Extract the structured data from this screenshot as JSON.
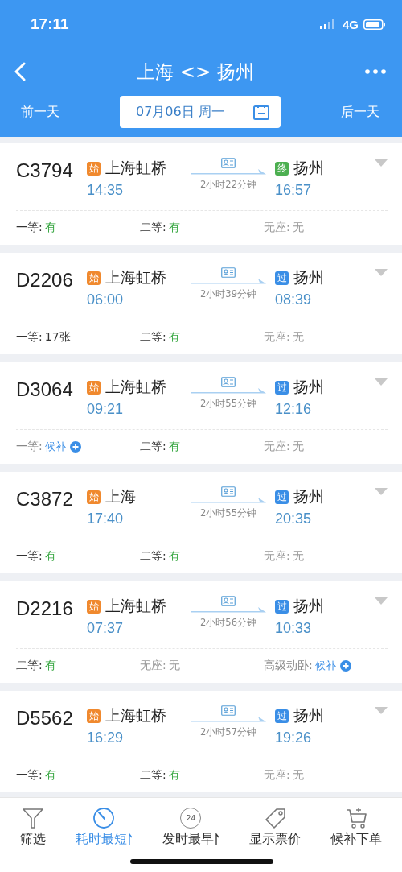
{
  "status_bar": {
    "time": "17:11",
    "network": "4G"
  },
  "nav": {
    "title": "上海 <> 扬州"
  },
  "date_bar": {
    "prev": "前一天",
    "date": "07月06日 周一",
    "next": "后一天"
  },
  "trains": [
    {
      "number": "C3794",
      "from": {
        "badge": "始",
        "color": "#f0892e",
        "station": "上海虹桥",
        "time": "14:35"
      },
      "duration": "2小时22分钟",
      "to": {
        "badge": "终",
        "color": "#4caf50",
        "station": "扬州",
        "time": "16:57"
      },
      "seats": [
        {
          "label": "一等:",
          "value": "有",
          "kind": "available"
        },
        {
          "label": "二等:",
          "value": "有",
          "kind": "available"
        },
        {
          "label": "无座:",
          "value": "无",
          "kind": "none"
        }
      ]
    },
    {
      "number": "D2206",
      "from": {
        "badge": "始",
        "color": "#f0892e",
        "station": "上海虹桥",
        "time": "06:00"
      },
      "duration": "2小时39分钟",
      "to": {
        "badge": "过",
        "color": "#3a8ee6",
        "station": "扬州",
        "time": "08:39"
      },
      "seats": [
        {
          "label": "一等:",
          "value": "17张",
          "kind": "count"
        },
        {
          "label": "二等:",
          "value": "有",
          "kind": "available"
        },
        {
          "label": "无座:",
          "value": "无",
          "kind": "none"
        }
      ]
    },
    {
      "number": "D3064",
      "from": {
        "badge": "始",
        "color": "#f0892e",
        "station": "上海虹桥",
        "time": "09:21"
      },
      "duration": "2小时55分钟",
      "to": {
        "badge": "过",
        "color": "#3a8ee6",
        "station": "扬州",
        "time": "12:16"
      },
      "seats": [
        {
          "label": "一等:",
          "value": "候补",
          "kind": "waitlist"
        },
        {
          "label": "二等:",
          "value": "有",
          "kind": "available"
        },
        {
          "label": "无座:",
          "value": "无",
          "kind": "none"
        }
      ]
    },
    {
      "number": "C3872",
      "from": {
        "badge": "始",
        "color": "#f0892e",
        "station": "上海",
        "time": "17:40"
      },
      "duration": "2小时55分钟",
      "to": {
        "badge": "过",
        "color": "#3a8ee6",
        "station": "扬州",
        "time": "20:35"
      },
      "seats": [
        {
          "label": "一等:",
          "value": "有",
          "kind": "available"
        },
        {
          "label": "二等:",
          "value": "有",
          "kind": "available"
        },
        {
          "label": "无座:",
          "value": "无",
          "kind": "none"
        }
      ]
    },
    {
      "number": "D2216",
      "from": {
        "badge": "始",
        "color": "#f0892e",
        "station": "上海虹桥",
        "time": "07:37"
      },
      "duration": "2小时56分钟",
      "to": {
        "badge": "过",
        "color": "#3a8ee6",
        "station": "扬州",
        "time": "10:33"
      },
      "seats": [
        {
          "label": "二等:",
          "value": "有",
          "kind": "available"
        },
        {
          "label": "无座:",
          "value": "无",
          "kind": "none"
        },
        {
          "label": "高级动卧:",
          "value": "候补",
          "kind": "waitlist"
        }
      ]
    },
    {
      "number": "D5562",
      "from": {
        "badge": "始",
        "color": "#f0892e",
        "station": "上海虹桥",
        "time": "16:29"
      },
      "duration": "2小时57分钟",
      "to": {
        "badge": "过",
        "color": "#3a8ee6",
        "station": "扬州",
        "time": "19:26"
      },
      "seats": [
        {
          "label": "一等:",
          "value": "有",
          "kind": "available"
        },
        {
          "label": "二等:",
          "value": "有",
          "kind": "available"
        },
        {
          "label": "无座:",
          "value": "无",
          "kind": "none"
        }
      ]
    }
  ],
  "toolbar": [
    {
      "label": "筛选",
      "kind": "filter",
      "selected": false,
      "sort": false
    },
    {
      "label": "耗时最短",
      "kind": "timer",
      "selected": true,
      "sort": true
    },
    {
      "label": "发时最早",
      "kind": "clock",
      "icon_text": "24",
      "selected": false,
      "sort": true
    },
    {
      "label": "显示票价",
      "kind": "tag",
      "selected": false,
      "sort": false
    },
    {
      "label": "候补下单",
      "kind": "cart",
      "selected": false,
      "sort": false
    }
  ]
}
